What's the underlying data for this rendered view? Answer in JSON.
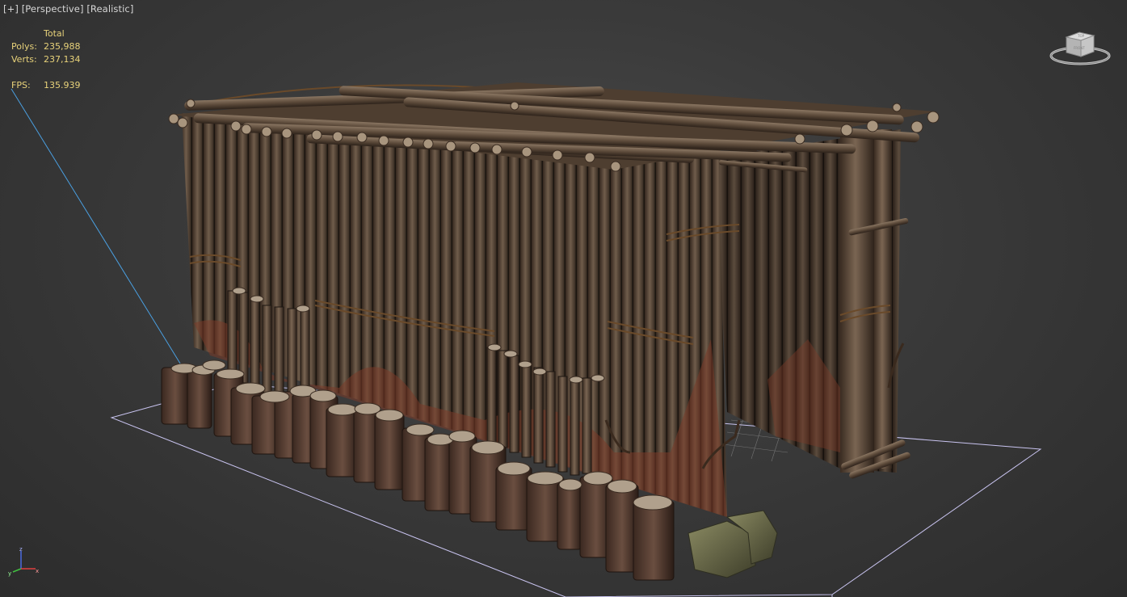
{
  "viewport": {
    "label_plus": "[+]",
    "label_view": "[Perspective]",
    "label_shading": "[Realistic]"
  },
  "stats": {
    "header": "Total",
    "polys_label": "Polys:",
    "polys_value": "235,988",
    "verts_label": "Verts:",
    "verts_value": "237,134",
    "fps_label": "FPS:",
    "fps_value": "135.939"
  },
  "viewcube": {
    "top_face_text": "TOP",
    "front_face_text": "FRONT"
  },
  "axis_tripod": {
    "x": "x",
    "y": "y",
    "z": "z"
  },
  "colors": {
    "background": "#3a3a3a",
    "stats_text": "#e8d27a",
    "grid_outline": "#c9c4f0",
    "light_line": "#4a9fe0",
    "wood": "#5a4535",
    "stone": "#6e6e4e"
  }
}
